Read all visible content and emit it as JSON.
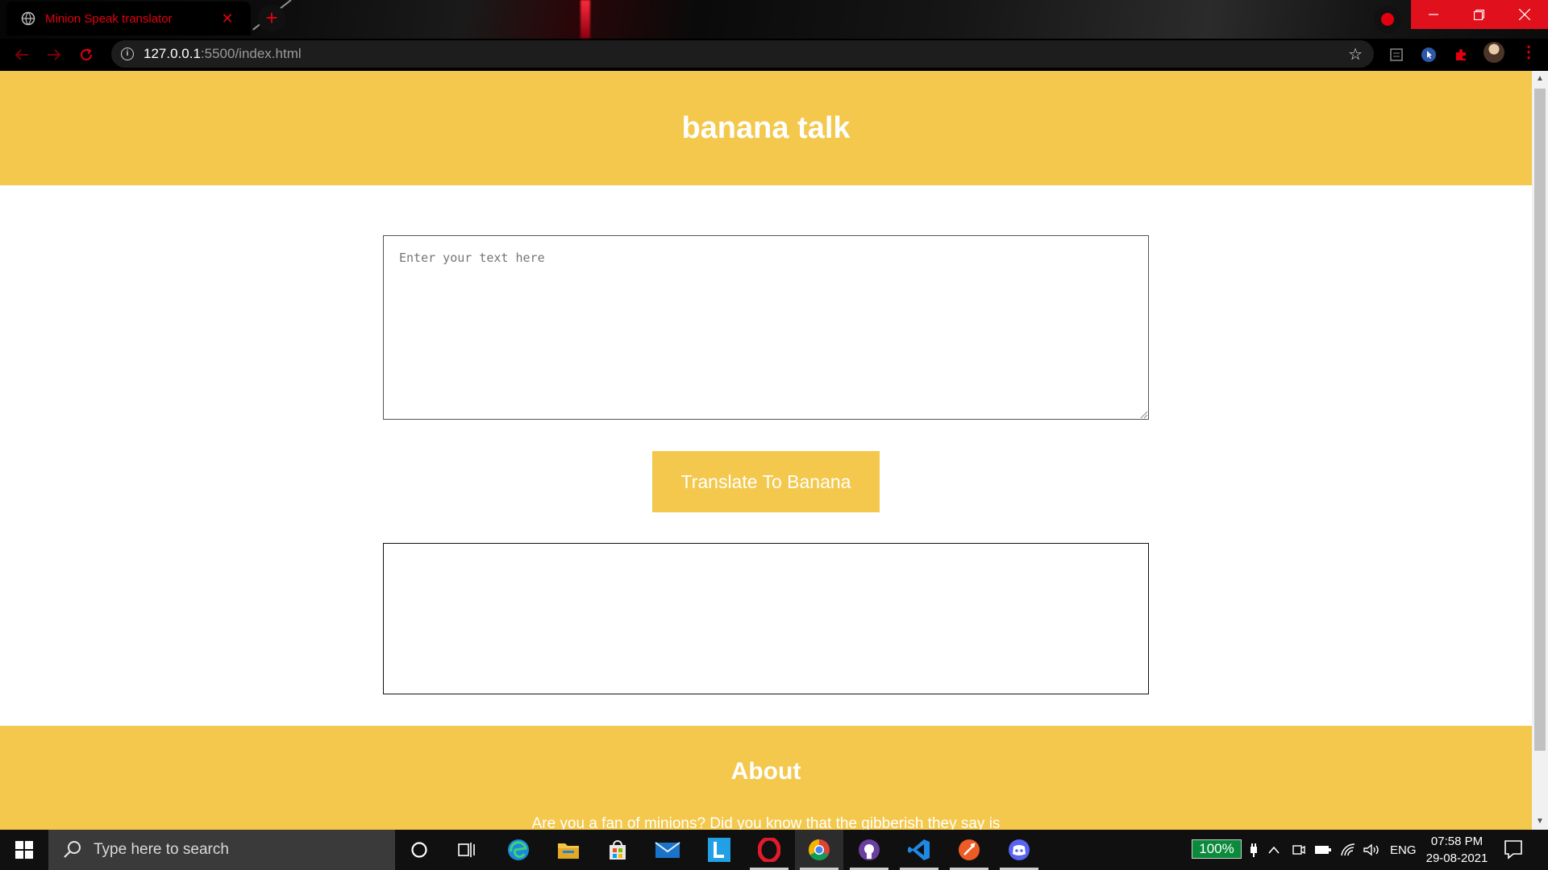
{
  "browser": {
    "tab_title": "Minion Speak translator",
    "tab_close": "✕",
    "new_tab": "+",
    "url_host": "127.0.0.1",
    "url_path": ":5500/index.html",
    "accent_color": "#e2000f"
  },
  "page": {
    "header_title": "banana talk",
    "input_placeholder": "Enter your text here",
    "translate_button": "Translate To Banana",
    "output_text": "",
    "about_title": "About",
    "about_text": "Are you a fan of minions? Did you know that the gibberish they say is",
    "brand_color": "#f3c84c"
  },
  "taskbar": {
    "search_placeholder": "Type here to search",
    "battery_percent": "100%",
    "language": "ENG",
    "time": "07:58 PM",
    "date": "29-08-2021"
  }
}
